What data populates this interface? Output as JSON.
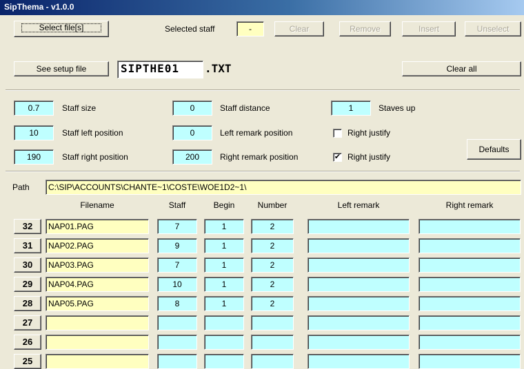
{
  "window": {
    "title": "SipThema - v1.0.0"
  },
  "toolbar": {
    "select_files": "Select file[s]",
    "selected_staff_label": "Selected staff",
    "selected_staff_value": "-",
    "clear": "Clear",
    "remove": "Remove",
    "insert": "Insert",
    "unselect": "Unselect",
    "see_setup": "See setup file",
    "setup_name": "SIPTHE01",
    "setup_ext": ".TXT",
    "clear_all": "Clear all"
  },
  "settings": {
    "staff_size": {
      "value": "0.7",
      "label": "Staff size"
    },
    "staff_left": {
      "value": "10",
      "label": "Staff left position"
    },
    "staff_right": {
      "value": "190",
      "label": "Staff right position"
    },
    "staff_distance": {
      "value": "0",
      "label": "Staff distance"
    },
    "left_remark": {
      "value": "0",
      "label": "Left remark position"
    },
    "right_remark": {
      "value": "200",
      "label": "Right remark position"
    },
    "staves_up": {
      "value": "1",
      "label": "Staves up"
    },
    "right_justify_1": {
      "label": "Right justify",
      "checked": false,
      "mark": ""
    },
    "right_justify_2": {
      "label": "Right justify",
      "checked": true,
      "mark": "✔"
    },
    "defaults": "Defaults"
  },
  "path": {
    "label": "Path",
    "value": "C:\\SIP\\ACCOUNTS\\CHANTE~1\\COSTE\\WOE1D2~1\\"
  },
  "table": {
    "headers": {
      "filename": "Filename",
      "staff": "Staff",
      "begin": "Begin",
      "number": "Number",
      "left_remark": "Left remark",
      "right_remark": "Right remark"
    },
    "rows": [
      {
        "num": "32",
        "filename": "NAP01.PAG",
        "staff": "7",
        "begin": "1",
        "number": "2",
        "left": "",
        "right": ""
      },
      {
        "num": "31",
        "filename": "NAP02.PAG",
        "staff": "9",
        "begin": "1",
        "number": "2",
        "left": "",
        "right": ""
      },
      {
        "num": "30",
        "filename": "NAP03.PAG",
        "staff": "7",
        "begin": "1",
        "number": "2",
        "left": "",
        "right": ""
      },
      {
        "num": "29",
        "filename": "NAP04.PAG",
        "staff": "10",
        "begin": "1",
        "number": "2",
        "left": "",
        "right": ""
      },
      {
        "num": "28",
        "filename": "NAP05.PAG",
        "staff": "8",
        "begin": "1",
        "number": "2",
        "left": "",
        "right": ""
      },
      {
        "num": "27",
        "filename": "",
        "staff": "",
        "begin": "",
        "number": "",
        "left": "",
        "right": ""
      },
      {
        "num": "26",
        "filename": "",
        "staff": "",
        "begin": "",
        "number": "",
        "left": "",
        "right": ""
      },
      {
        "num": "25",
        "filename": "",
        "staff": "",
        "begin": "",
        "number": "",
        "left": "",
        "right": ""
      }
    ]
  }
}
